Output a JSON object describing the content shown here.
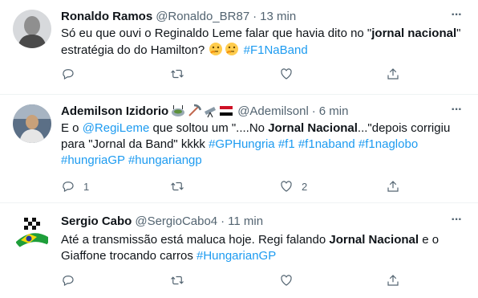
{
  "tweets": [
    {
      "name": "Ronaldo Ramos",
      "handle": "@Ronaldo_BR87",
      "time": "13 min",
      "text_parts": [
        "Só eu que ouvi o Reginaldo Leme falar que havia dito no \"",
        "jornal nacional",
        "\" estratégia do do Hamilton? ",
        "#F1NaBand"
      ],
      "counts": {
        "reply": "",
        "retweet": "",
        "like": ""
      }
    },
    {
      "name": "Ademilson Izidorio",
      "handle": "@Ademilsonl",
      "time": "6 min",
      "text_parts": [
        "E o ",
        "@RegiLeme",
        " que soltou um \"....No ",
        "Jornal Nacional",
        "...\"depois corrigiu para \"Jornal da Band\" kkkk ",
        "#GPHungria",
        " ",
        "#f1",
        " ",
        "#f1naband",
        " ",
        "#f1naglobo",
        " ",
        "#hungriaGP",
        " ",
        "#hungariangp"
      ],
      "counts": {
        "reply": "1",
        "retweet": "",
        "like": "2"
      }
    },
    {
      "name": "Sergio Cabo",
      "handle": "@SergioCabo4",
      "time": "11 min",
      "text_parts": [
        "Até a transmissão está maluca hoje. Regi falando ",
        "Jornal Nacional",
        " e o Giaffone trocando carros ",
        "#HungarianGP"
      ],
      "counts": {
        "reply": "",
        "retweet": "",
        "like": ""
      }
    }
  ],
  "sep": "·",
  "icons": [
    "more-icon",
    "reply-icon",
    "retweet-icon",
    "like-icon",
    "share-icon",
    "thinking-emoji",
    "stadium-emoji",
    "pickaxe-emoji",
    "telescope-emoji",
    "yemen-flag-emoji"
  ],
  "colors": {
    "link": "#1d9bf0",
    "muted": "#536471",
    "text": "#0f1419",
    "divider": "#eff3f4"
  }
}
